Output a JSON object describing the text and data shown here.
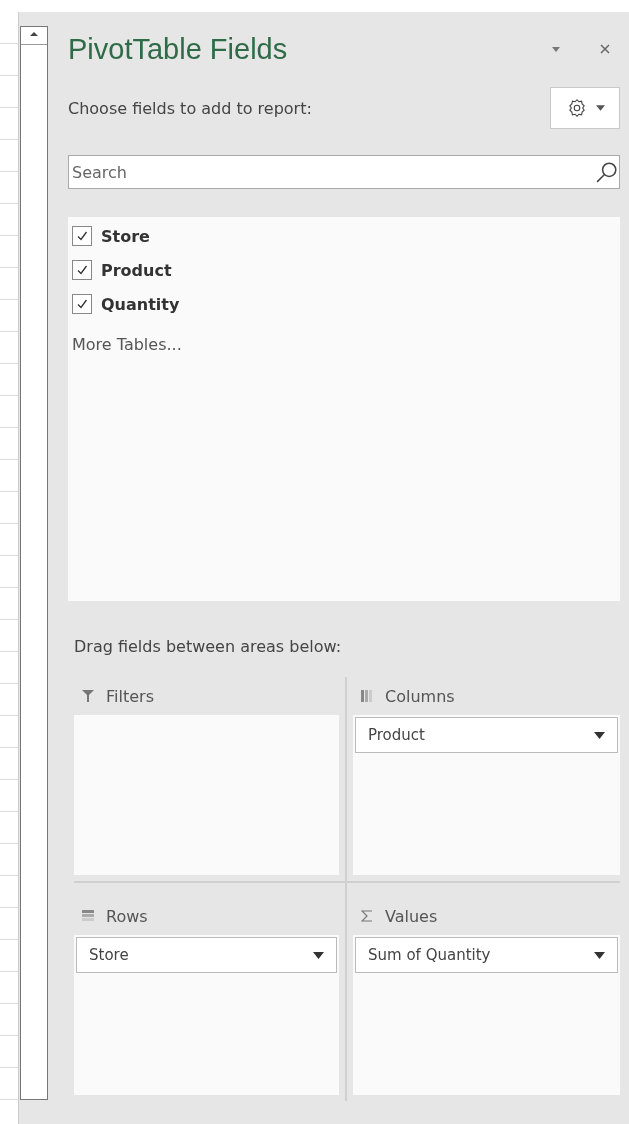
{
  "pane": {
    "title": "PivotTable Fields",
    "subtitle": "Choose fields to add to report:"
  },
  "search": {
    "placeholder": "Search"
  },
  "fields": [
    {
      "label": "Store",
      "checked": true
    },
    {
      "label": "Product",
      "checked": true
    },
    {
      "label": "Quantity",
      "checked": true
    }
  ],
  "more_tables": "More Tables...",
  "areas_label": "Drag fields between areas below:",
  "areas": [
    {
      "kind": "filters",
      "label": "Filters"
    },
    {
      "kind": "columns",
      "label": "Columns",
      "items": [
        "Product"
      ]
    },
    {
      "kind": "rows",
      "label": "Rows",
      "items": [
        "Store"
      ]
    },
    {
      "kind": "values",
      "label": "Values",
      "items": [
        "Sum of Quantity"
      ]
    }
  ]
}
